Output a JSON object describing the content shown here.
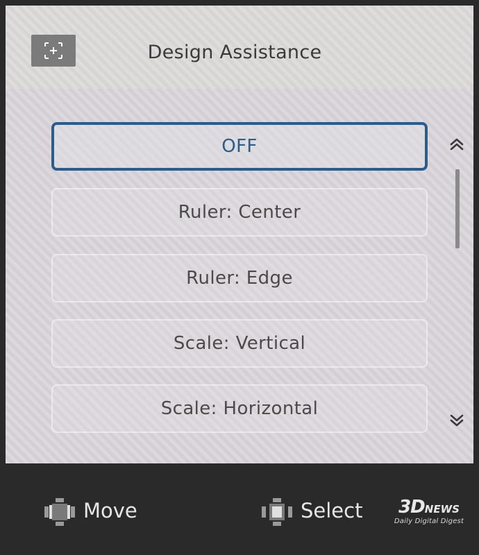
{
  "header": {
    "title": "Design Assistance",
    "icon": "crosshair-frame-icon"
  },
  "menu": {
    "items": [
      {
        "label": "OFF",
        "selected": true
      },
      {
        "label": "Ruler: Center",
        "selected": false
      },
      {
        "label": "Ruler: Edge",
        "selected": false
      },
      {
        "label": "Scale: Vertical",
        "selected": false
      },
      {
        "label": "Scale: Horizontal",
        "selected": false
      }
    ],
    "scroll_position": 0.0
  },
  "footer": {
    "move_label": "Move",
    "select_label": "Select"
  },
  "watermark": {
    "logo_main": "3D",
    "logo_suffix": "NEWS",
    "tagline": "Daily Digital Digest"
  },
  "colors": {
    "accent": "#2c5c8c",
    "panel_bg": "#d9d5d8",
    "footer_bg": "#2a2a2a"
  }
}
